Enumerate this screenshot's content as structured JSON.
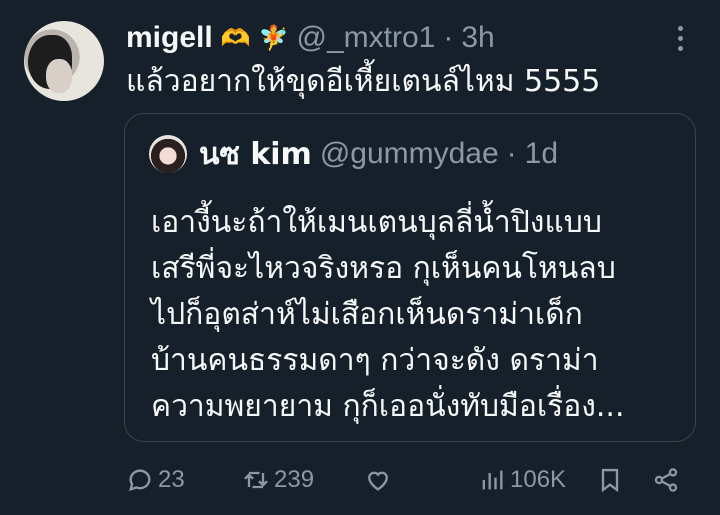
{
  "tweet": {
    "author_name": "migell",
    "author_emoji_1": "🫶",
    "author_emoji_2": "🧚",
    "handle": "@_mxtro1",
    "separator": "·",
    "time": "3h",
    "text": "แล้วอยากให้ขุดอีเหี้ยเตนล์ไหม 5555"
  },
  "quote": {
    "author_name": "นซ kim",
    "handle": "@gummydae",
    "separator": "·",
    "time": "1d",
    "lines": [
      "เอางี้นะถ้าให้เมนเตนบุลลี่น้ำปิงแบบ",
      "เสรีพี่จะไหวจริงหรอ กุเห็นคนโหนลบ",
      "ไปก็อุตส่าห์ไม่เสือกเห็นดราม่าเด็ก",
      "บ้านคนธรรมดาๆ กว่าจะดัง ดราม่า",
      "ความพยายาม กุก็เออนั่งทับมือเรื่อง..."
    ]
  },
  "actions": {
    "reply_count": "23",
    "retweet_count": "239",
    "views_count": "106K"
  },
  "icons": [
    "more-icon",
    "reply-icon",
    "retweet-icon",
    "like-icon",
    "views-icon",
    "bookmark-icon",
    "share-icon"
  ],
  "colors": {
    "background": "#15202b",
    "text": "#f7f9f9",
    "secondary": "#8b98a5",
    "border": "#38444d"
  }
}
